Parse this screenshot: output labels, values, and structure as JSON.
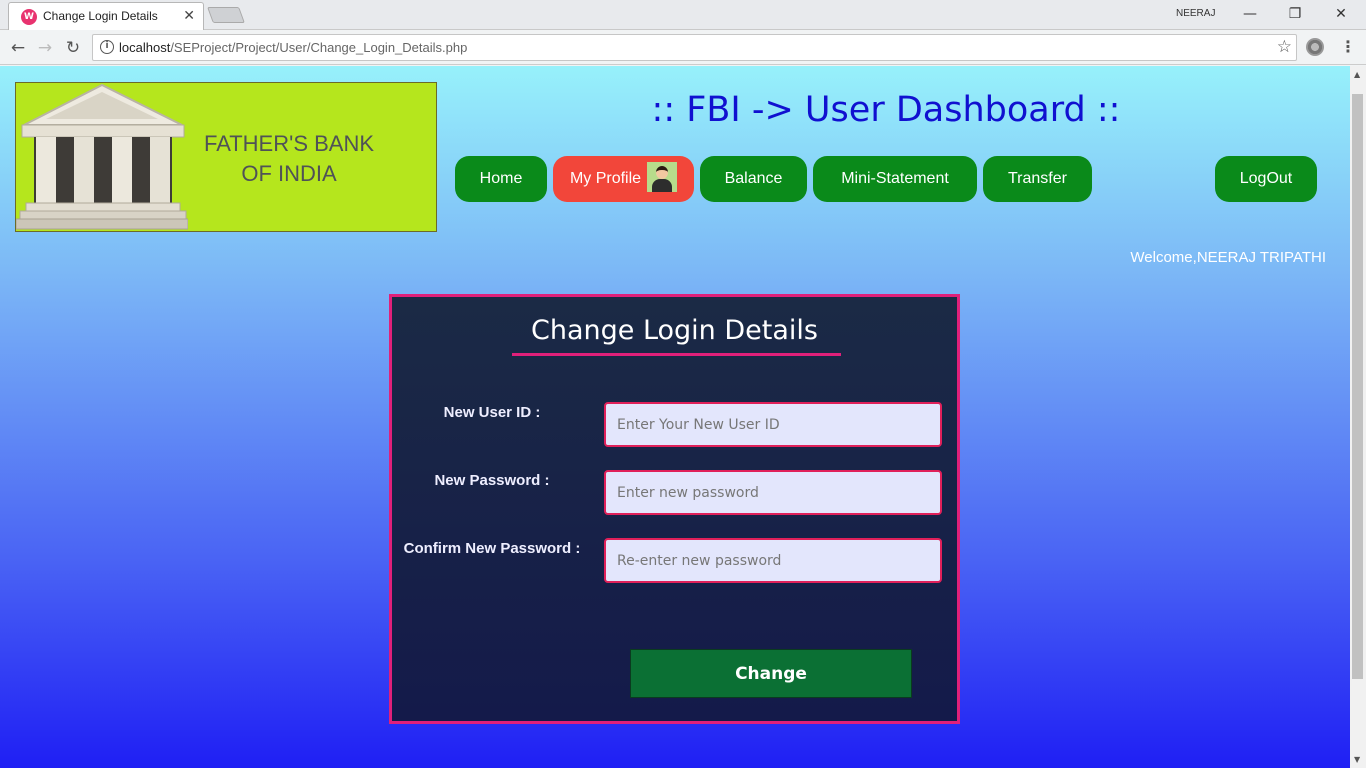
{
  "browser": {
    "tab_title": "Change Login Details",
    "tab_favicon_letter": "W",
    "profile_name": "NEERAJ",
    "url_host": "localhost",
    "url_path": "/SEProject/Project/User/Change_Login_Details.php"
  },
  "header": {
    "bank_name_line1": "FATHER'S BANK",
    "bank_name_line2": "OF INDIA",
    "dashboard_title": ":: FBI -> User Dashboard ::"
  },
  "nav": {
    "home": "Home",
    "my_profile": "My Profile",
    "balance": "Balance",
    "mini_statement": "Mini-Statement",
    "transfer": "Transfer",
    "logout": "LogOut",
    "active_item": "My Profile"
  },
  "welcome_text": "Welcome,NEERAJ TRIPATHI",
  "form": {
    "title": "Change Login Details",
    "fields": [
      {
        "label": "New User ID :",
        "placeholder": "Enter Your New User ID",
        "value": ""
      },
      {
        "label": "New Password :",
        "placeholder": "Enter new password",
        "value": ""
      },
      {
        "label": "Confirm New Password :",
        "placeholder": "Re-enter new password",
        "value": ""
      }
    ],
    "submit_label": "Change"
  },
  "colors": {
    "nav_button": "#0a8a1a",
    "nav_active": "#f2463a",
    "panel_border": "#e0207a",
    "title_blue": "#1010d0",
    "logo_bg": "#b5e61d",
    "submit_button": "#0b7034"
  }
}
